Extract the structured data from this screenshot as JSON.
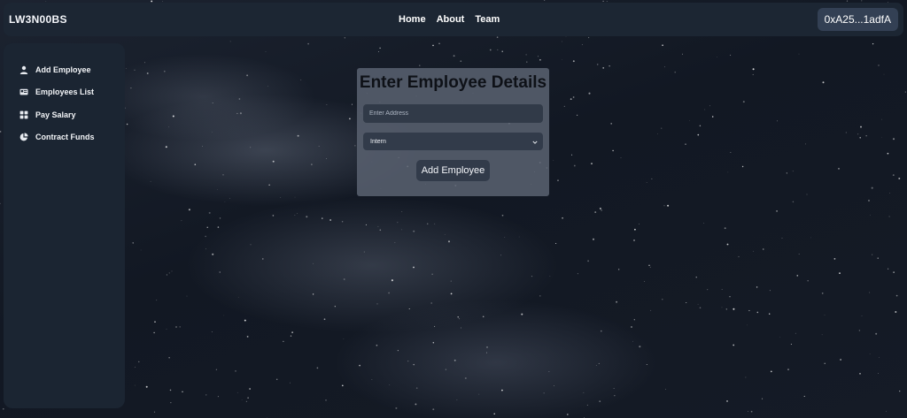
{
  "header": {
    "brand": "LW3N00BS",
    "nav": [
      "Home",
      "About",
      "Team"
    ],
    "wallet": "0xA25...1adfA"
  },
  "sidebar": {
    "items": [
      {
        "label": "Add Employee",
        "icon": "user-icon"
      },
      {
        "label": "Employees List",
        "icon": "id-card-icon"
      },
      {
        "label": "Pay Salary",
        "icon": "grid-icon"
      },
      {
        "label": "Contract Funds",
        "icon": "pie-chart-icon"
      }
    ]
  },
  "form": {
    "title": "Enter Employee Details",
    "address_placeholder": "Enter Address",
    "address_value": "",
    "role_selected": "Intern",
    "submit_label": "Add Employee"
  },
  "colors": {
    "navbar": "#1c2633",
    "sidebar": "#1b2532",
    "card": "#58606e",
    "control": "#323b4a"
  }
}
